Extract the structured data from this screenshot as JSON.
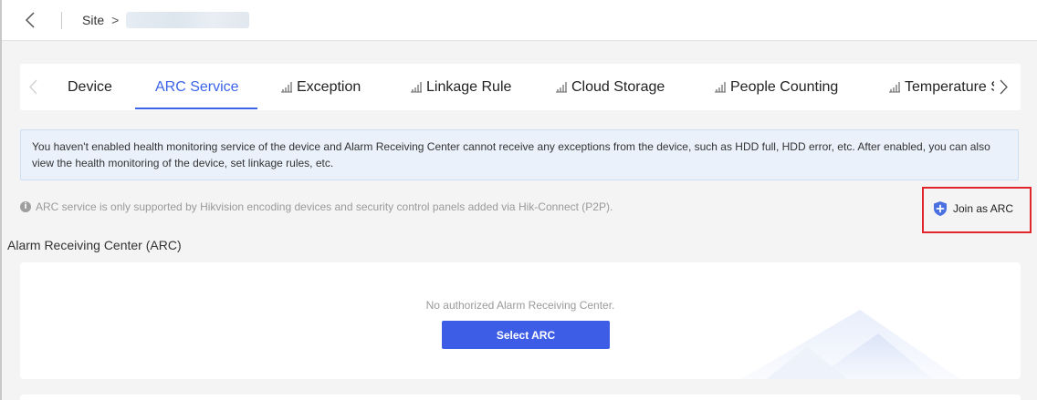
{
  "colors": {
    "accent": "#3c64e8",
    "button": "#3d5de7",
    "highlight_box": "#e0262b",
    "banner_bg": "#eaf1fb"
  },
  "header": {
    "back_icon": "chevron-left-icon",
    "breadcrumb_root": "Site",
    "breadcrumb_separator": ">"
  },
  "tabs": {
    "items": [
      {
        "label": "Device",
        "icon": ""
      },
      {
        "label": "ARC Service",
        "icon": "",
        "active": true
      },
      {
        "label": "Exception",
        "icon": "signal-bars-icon"
      },
      {
        "label": "Linkage Rule",
        "icon": "signal-bars-icon"
      },
      {
        "label": "Cloud Storage",
        "icon": "signal-bars-icon"
      },
      {
        "label": "People Counting",
        "icon": "signal-bars-icon"
      },
      {
        "label": "Temperature S",
        "icon": "signal-bars-icon"
      }
    ],
    "prev_icon": "chevron-left-icon",
    "next_icon": "chevron-right-icon"
  },
  "banner": {
    "text": "You haven't enabled health monitoring service of the device and Alarm Receiving Center cannot receive any exceptions from the device, such as HDD full, HDD error, etc. After enabled, you can also view the health monitoring of the device, set linkage rules, etc."
  },
  "note": {
    "icon": "info-icon",
    "text": "ARC service is only supported by Hikvision encoding devices and security control panels added via Hik-Connect (P2P)."
  },
  "join": {
    "icon": "shield-plus-icon",
    "label": "Join as ARC"
  },
  "section": {
    "title": "Alarm Receiving Center (ARC)",
    "empty_text": "No authorized Alarm Receiving Center.",
    "select_label": "Select ARC"
  }
}
